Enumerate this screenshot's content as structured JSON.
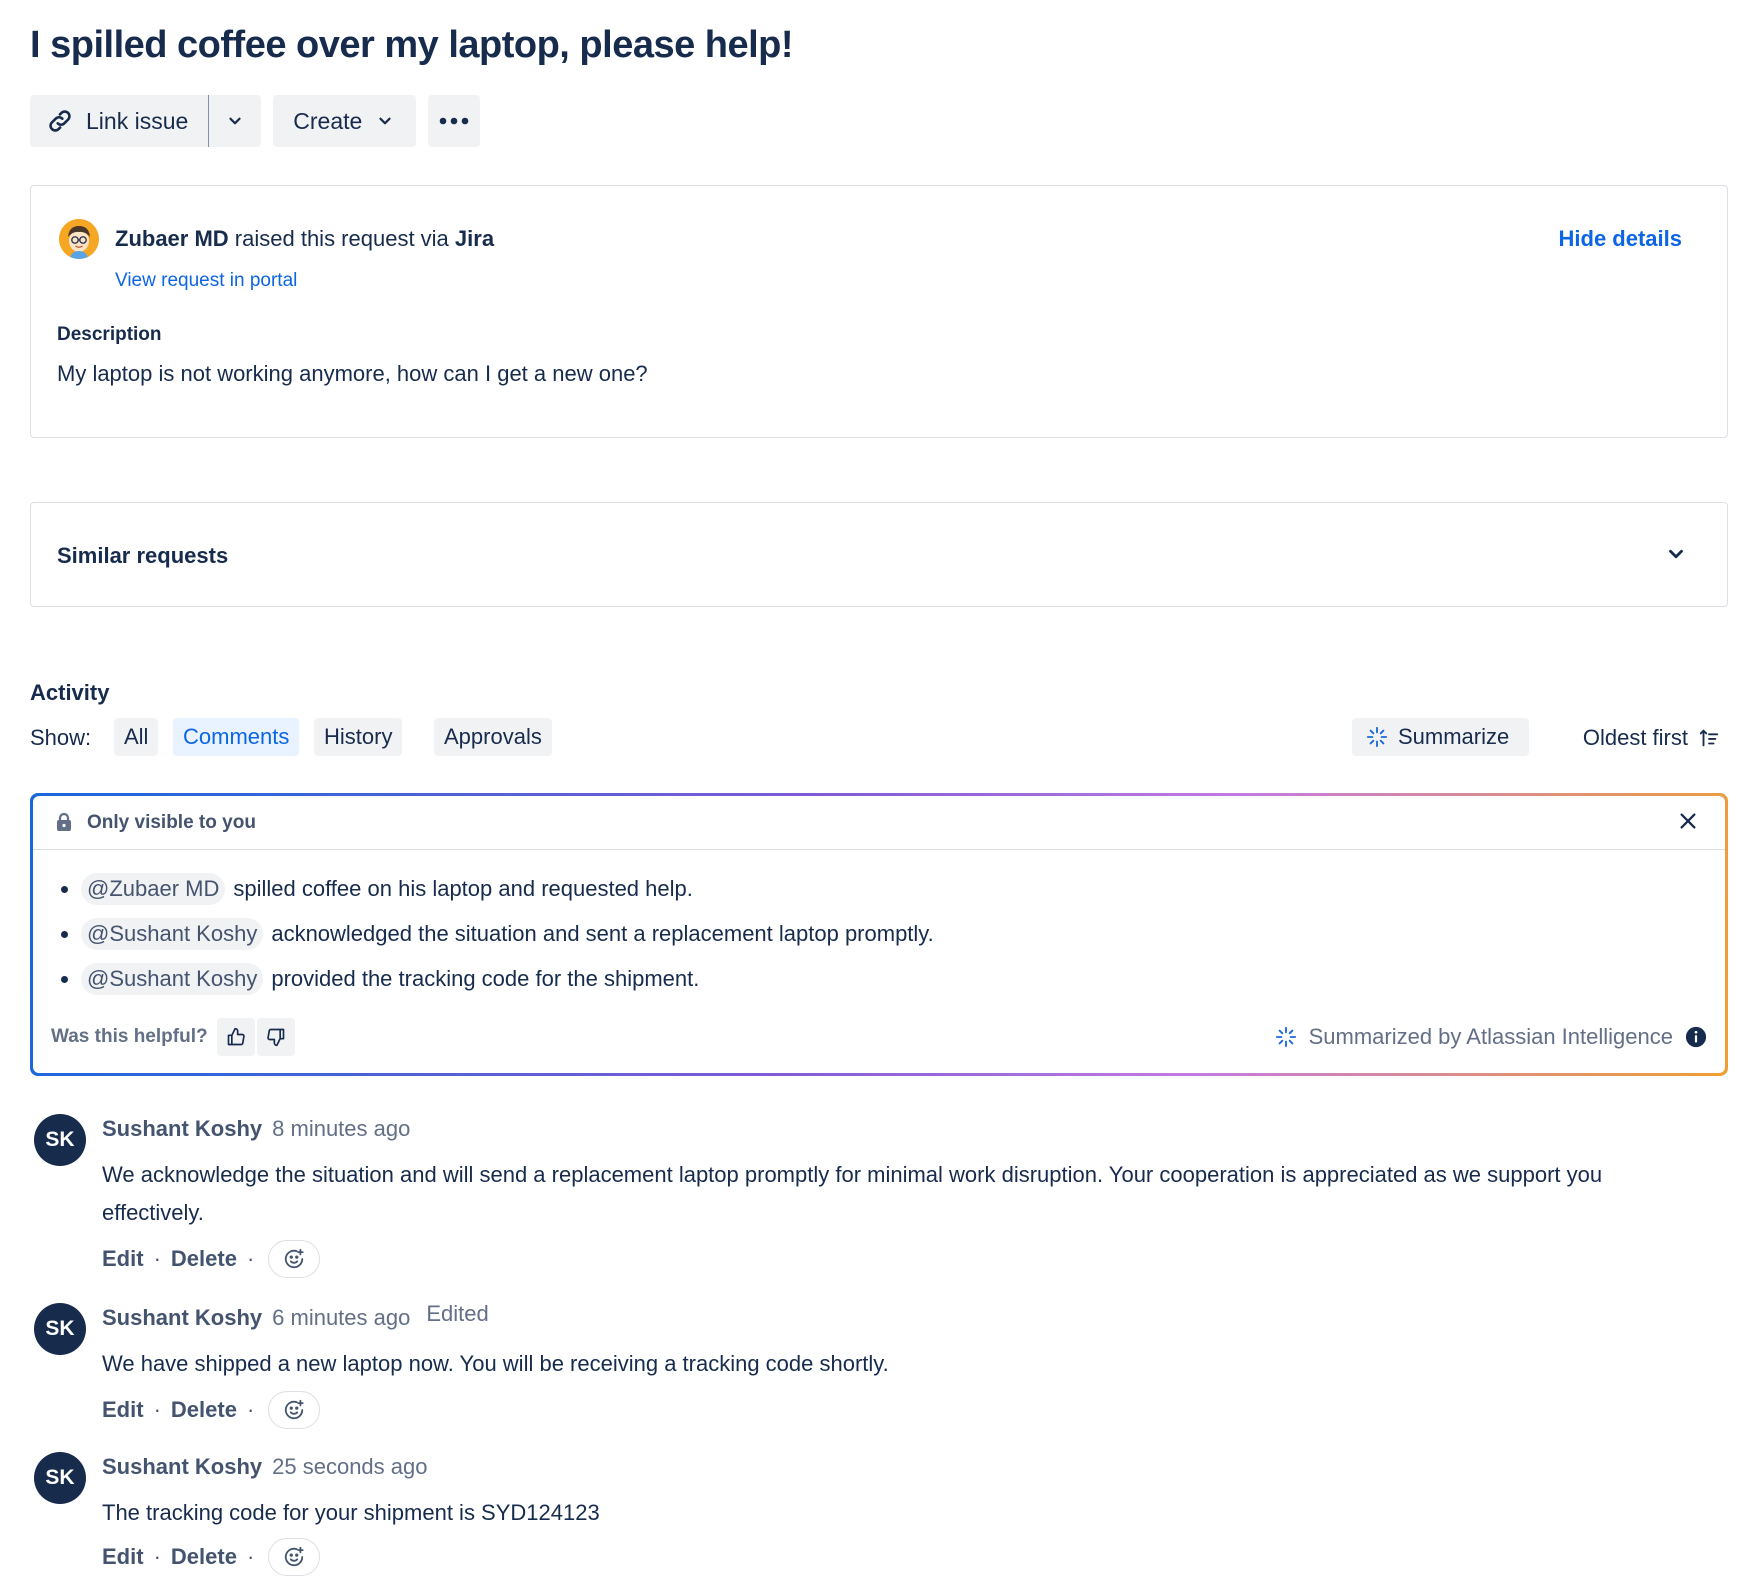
{
  "issue": {
    "title": "I spilled coffee over my laptop, please help!"
  },
  "toolbar": {
    "link_issue_label": "Link issue",
    "create_label": "Create"
  },
  "request": {
    "reporter": "Zubaer MD",
    "raised_text": " raised this request via ",
    "channel": "Jira",
    "portal_link": "View request in portal",
    "hide_details": "Hide details",
    "description_label": "Description",
    "description": "My laptop is not working anymore, how can I get a new one?"
  },
  "similar": {
    "title": "Similar requests"
  },
  "activity": {
    "label": "Activity",
    "show_label": "Show:",
    "filters": [
      "All",
      "Comments",
      "History",
      "Approvals"
    ],
    "active_filter": "Comments",
    "summarize_label": "Summarize",
    "sort_label": "Oldest first"
  },
  "ai_summary": {
    "visibility": "Only visible to you",
    "items": [
      {
        "mention": "@Zubaer MD",
        "text": "spilled coffee on his laptop and requested help."
      },
      {
        "mention": "@Sushant Koshy",
        "text": "acknowledged the situation and sent a replacement laptop promptly."
      },
      {
        "mention": "@Sushant Koshy",
        "text": "provided the tracking code for the shipment."
      }
    ],
    "helpful_label": "Was this helpful?",
    "credit": "Summarized by Atlassian Intelligence",
    "accent_colors": [
      "#1868db",
      "#7f5bd6",
      "#c47be0",
      "#f0a030"
    ]
  },
  "comments": [
    {
      "initials": "SK",
      "author": "Sushant Koshy",
      "time": "8 minutes ago",
      "edited": "",
      "body": "We acknowledge the situation and will send a replacement laptop promptly for minimal work disruption. Your cooperation is appreciated as we support you effectively.",
      "edit_label": "Edit",
      "delete_label": "Delete"
    },
    {
      "initials": "SK",
      "author": "Sushant Koshy",
      "time": "6 minutes ago",
      "edited": "Edited",
      "body": "We have shipped a new laptop now. You will be receiving a tracking code shortly.",
      "edit_label": "Edit",
      "delete_label": "Delete"
    },
    {
      "initials": "SK",
      "author": "Sushant Koshy",
      "time": "25 seconds ago",
      "edited": "",
      "body": "The tracking code for your shipment is SYD124123",
      "edit_label": "Edit",
      "delete_label": "Delete"
    }
  ],
  "colors": {
    "text": "#172b4d",
    "link": "#0c66e4",
    "subtle": "#626f86",
    "surface": "#f1f2f4"
  }
}
